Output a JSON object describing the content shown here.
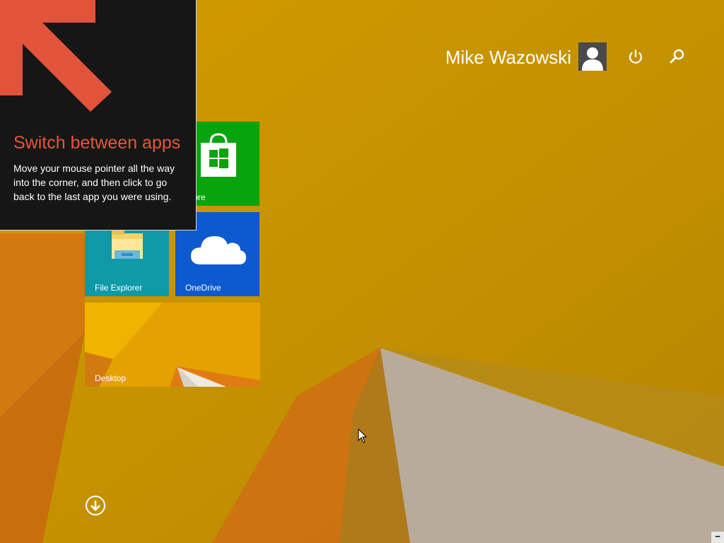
{
  "user": {
    "name": "Mike Wazowski"
  },
  "tiles": {
    "store": {
      "label": "Store",
      "visible_label": "ore"
    },
    "file_explorer": {
      "label": "File Explorer"
    },
    "onedrive": {
      "label": "OneDrive"
    },
    "desktop": {
      "label": "Desktop"
    }
  },
  "tip": {
    "title": "Switch between apps",
    "body": "Move your mouse pointer all the way into the corner, and then click to go back to the last app you were using."
  },
  "colors": {
    "accent_tip_title": "#e7563a",
    "arrow": "#e2543a",
    "store_tile": "#08a40e",
    "explorer_tile": "#0e9aa7",
    "onedrive_tile": "#0d5ad0",
    "wallpaper": "#c89000"
  },
  "corner_button": {
    "label": "−"
  }
}
